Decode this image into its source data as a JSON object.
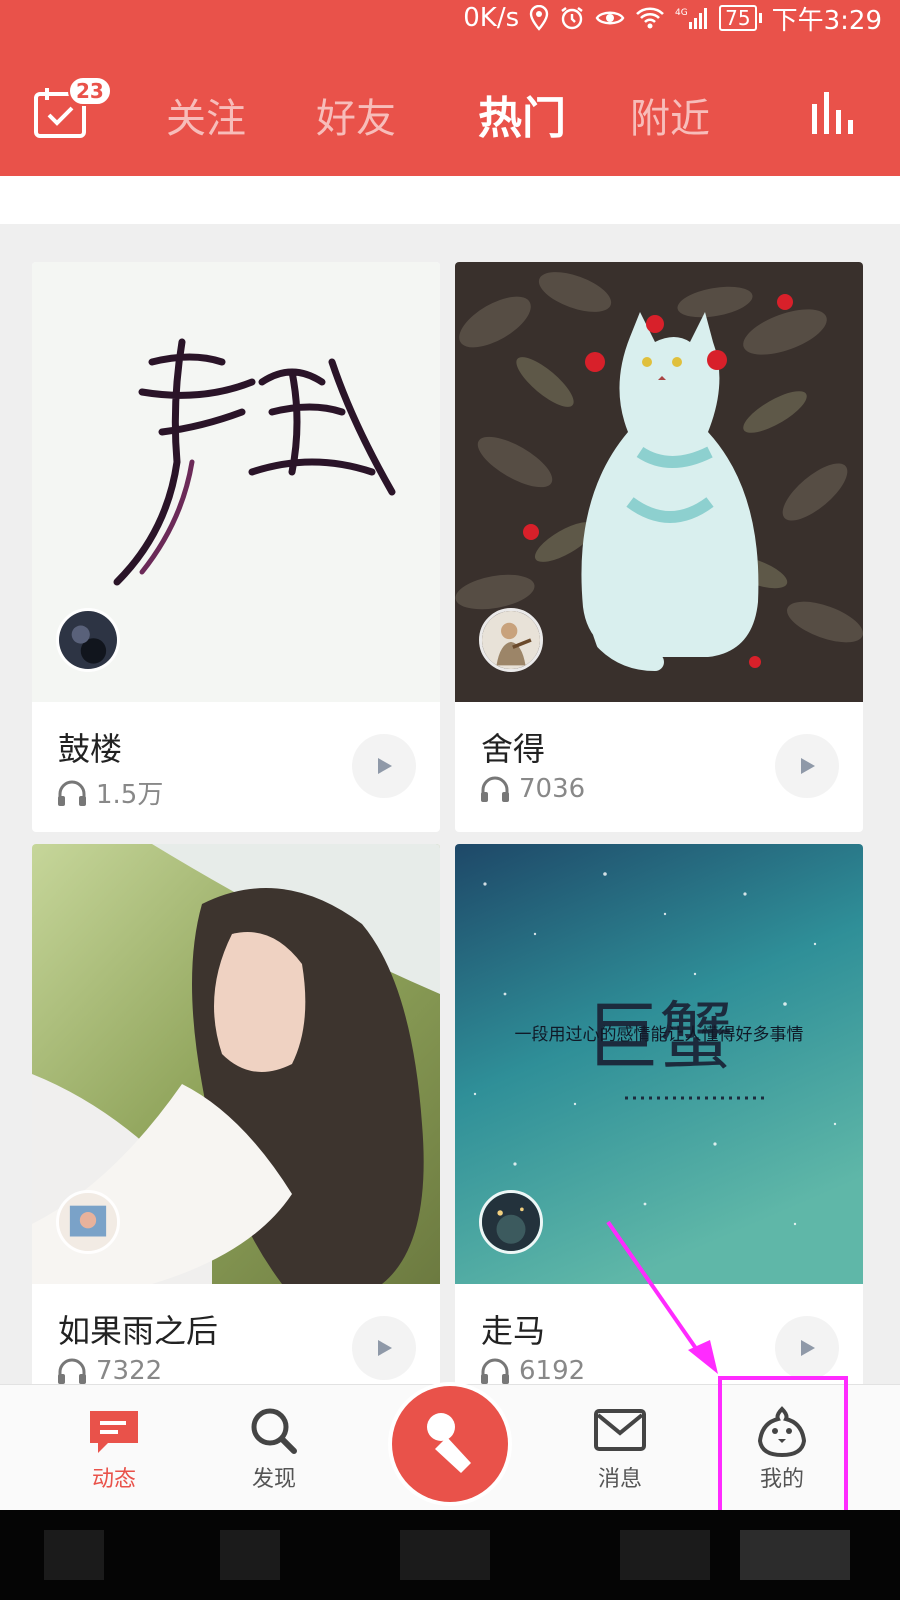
{
  "status_bar": {
    "net_speed": "0K/s",
    "battery": "75",
    "time": "下午3:29"
  },
  "header": {
    "calendar_badge": "23",
    "tabs": [
      {
        "label": "关注",
        "active": false
      },
      {
        "label": "好友",
        "active": false
      },
      {
        "label": "热门",
        "active": true
      },
      {
        "label": "附近",
        "active": false
      }
    ]
  },
  "feed": {
    "cards": [
      {
        "title": "鼓楼",
        "plays": "1.5万",
        "cover_text": "静默"
      },
      {
        "title": "舍得",
        "plays": "7036"
      },
      {
        "title": "如果雨之后",
        "plays": "7322"
      },
      {
        "title": "走马",
        "plays": "6192",
        "cover_text": "巨蟹",
        "cover_subtext": "一段用过心的感情能让人懂得好多事情"
      }
    ]
  },
  "bottom_nav": {
    "items": [
      {
        "label": "动态",
        "icon": "chat-bubble-icon",
        "active": true
      },
      {
        "label": "发现",
        "icon": "search-icon",
        "active": false
      },
      {
        "label": "消息",
        "icon": "envelope-icon",
        "active": false
      },
      {
        "label": "我的",
        "icon": "bird-mascot-icon",
        "active": false
      }
    ]
  },
  "colors": {
    "brand_red": "#e9524a",
    "annotation_magenta": "#ff2bff"
  }
}
